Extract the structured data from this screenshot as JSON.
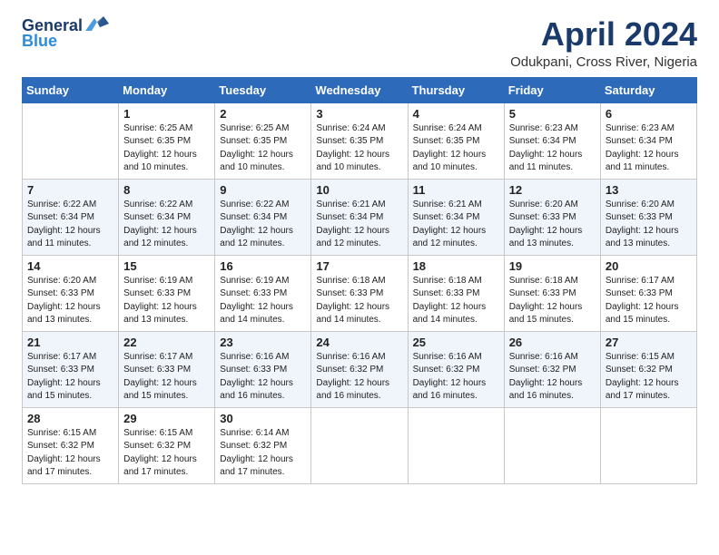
{
  "header": {
    "logo_general": "General",
    "logo_blue": "Blue",
    "title": "April 2024",
    "subtitle": "Odukpani, Cross River, Nigeria"
  },
  "days_of_week": [
    "Sunday",
    "Monday",
    "Tuesday",
    "Wednesday",
    "Thursday",
    "Friday",
    "Saturday"
  ],
  "weeks": [
    [
      {
        "day": "",
        "sunrise": "",
        "sunset": "",
        "daylight": ""
      },
      {
        "day": "1",
        "sunrise": "Sunrise: 6:25 AM",
        "sunset": "Sunset: 6:35 PM",
        "daylight": "Daylight: 12 hours and 10 minutes."
      },
      {
        "day": "2",
        "sunrise": "Sunrise: 6:25 AM",
        "sunset": "Sunset: 6:35 PM",
        "daylight": "Daylight: 12 hours and 10 minutes."
      },
      {
        "day": "3",
        "sunrise": "Sunrise: 6:24 AM",
        "sunset": "Sunset: 6:35 PM",
        "daylight": "Daylight: 12 hours and 10 minutes."
      },
      {
        "day": "4",
        "sunrise": "Sunrise: 6:24 AM",
        "sunset": "Sunset: 6:35 PM",
        "daylight": "Daylight: 12 hours and 10 minutes."
      },
      {
        "day": "5",
        "sunrise": "Sunrise: 6:23 AM",
        "sunset": "Sunset: 6:34 PM",
        "daylight": "Daylight: 12 hours and 11 minutes."
      },
      {
        "day": "6",
        "sunrise": "Sunrise: 6:23 AM",
        "sunset": "Sunset: 6:34 PM",
        "daylight": "Daylight: 12 hours and 11 minutes."
      }
    ],
    [
      {
        "day": "7",
        "sunrise": "Sunrise: 6:22 AM",
        "sunset": "Sunset: 6:34 PM",
        "daylight": "Daylight: 12 hours and 11 minutes."
      },
      {
        "day": "8",
        "sunrise": "Sunrise: 6:22 AM",
        "sunset": "Sunset: 6:34 PM",
        "daylight": "Daylight: 12 hours and 12 minutes."
      },
      {
        "day": "9",
        "sunrise": "Sunrise: 6:22 AM",
        "sunset": "Sunset: 6:34 PM",
        "daylight": "Daylight: 12 hours and 12 minutes."
      },
      {
        "day": "10",
        "sunrise": "Sunrise: 6:21 AM",
        "sunset": "Sunset: 6:34 PM",
        "daylight": "Daylight: 12 hours and 12 minutes."
      },
      {
        "day": "11",
        "sunrise": "Sunrise: 6:21 AM",
        "sunset": "Sunset: 6:34 PM",
        "daylight": "Daylight: 12 hours and 12 minutes."
      },
      {
        "day": "12",
        "sunrise": "Sunrise: 6:20 AM",
        "sunset": "Sunset: 6:33 PM",
        "daylight": "Daylight: 12 hours and 13 minutes."
      },
      {
        "day": "13",
        "sunrise": "Sunrise: 6:20 AM",
        "sunset": "Sunset: 6:33 PM",
        "daylight": "Daylight: 12 hours and 13 minutes."
      }
    ],
    [
      {
        "day": "14",
        "sunrise": "Sunrise: 6:20 AM",
        "sunset": "Sunset: 6:33 PM",
        "daylight": "Daylight: 12 hours and 13 minutes."
      },
      {
        "day": "15",
        "sunrise": "Sunrise: 6:19 AM",
        "sunset": "Sunset: 6:33 PM",
        "daylight": "Daylight: 12 hours and 13 minutes."
      },
      {
        "day": "16",
        "sunrise": "Sunrise: 6:19 AM",
        "sunset": "Sunset: 6:33 PM",
        "daylight": "Daylight: 12 hours and 14 minutes."
      },
      {
        "day": "17",
        "sunrise": "Sunrise: 6:18 AM",
        "sunset": "Sunset: 6:33 PM",
        "daylight": "Daylight: 12 hours and 14 minutes."
      },
      {
        "day": "18",
        "sunrise": "Sunrise: 6:18 AM",
        "sunset": "Sunset: 6:33 PM",
        "daylight": "Daylight: 12 hours and 14 minutes."
      },
      {
        "day": "19",
        "sunrise": "Sunrise: 6:18 AM",
        "sunset": "Sunset: 6:33 PM",
        "daylight": "Daylight: 12 hours and 15 minutes."
      },
      {
        "day": "20",
        "sunrise": "Sunrise: 6:17 AM",
        "sunset": "Sunset: 6:33 PM",
        "daylight": "Daylight: 12 hours and 15 minutes."
      }
    ],
    [
      {
        "day": "21",
        "sunrise": "Sunrise: 6:17 AM",
        "sunset": "Sunset: 6:33 PM",
        "daylight": "Daylight: 12 hours and 15 minutes."
      },
      {
        "day": "22",
        "sunrise": "Sunrise: 6:17 AM",
        "sunset": "Sunset: 6:33 PM",
        "daylight": "Daylight: 12 hours and 15 minutes."
      },
      {
        "day": "23",
        "sunrise": "Sunrise: 6:16 AM",
        "sunset": "Sunset: 6:33 PM",
        "daylight": "Daylight: 12 hours and 16 minutes."
      },
      {
        "day": "24",
        "sunrise": "Sunrise: 6:16 AM",
        "sunset": "Sunset: 6:32 PM",
        "daylight": "Daylight: 12 hours and 16 minutes."
      },
      {
        "day": "25",
        "sunrise": "Sunrise: 6:16 AM",
        "sunset": "Sunset: 6:32 PM",
        "daylight": "Daylight: 12 hours and 16 minutes."
      },
      {
        "day": "26",
        "sunrise": "Sunrise: 6:16 AM",
        "sunset": "Sunset: 6:32 PM",
        "daylight": "Daylight: 12 hours and 16 minutes."
      },
      {
        "day": "27",
        "sunrise": "Sunrise: 6:15 AM",
        "sunset": "Sunset: 6:32 PM",
        "daylight": "Daylight: 12 hours and 17 minutes."
      }
    ],
    [
      {
        "day": "28",
        "sunrise": "Sunrise: 6:15 AM",
        "sunset": "Sunset: 6:32 PM",
        "daylight": "Daylight: 12 hours and 17 minutes."
      },
      {
        "day": "29",
        "sunrise": "Sunrise: 6:15 AM",
        "sunset": "Sunset: 6:32 PM",
        "daylight": "Daylight: 12 hours and 17 minutes."
      },
      {
        "day": "30",
        "sunrise": "Sunrise: 6:14 AM",
        "sunset": "Sunset: 6:32 PM",
        "daylight": "Daylight: 12 hours and 17 minutes."
      },
      {
        "day": "",
        "sunrise": "",
        "sunset": "",
        "daylight": ""
      },
      {
        "day": "",
        "sunrise": "",
        "sunset": "",
        "daylight": ""
      },
      {
        "day": "",
        "sunrise": "",
        "sunset": "",
        "daylight": ""
      },
      {
        "day": "",
        "sunrise": "",
        "sunset": "",
        "daylight": ""
      }
    ]
  ]
}
